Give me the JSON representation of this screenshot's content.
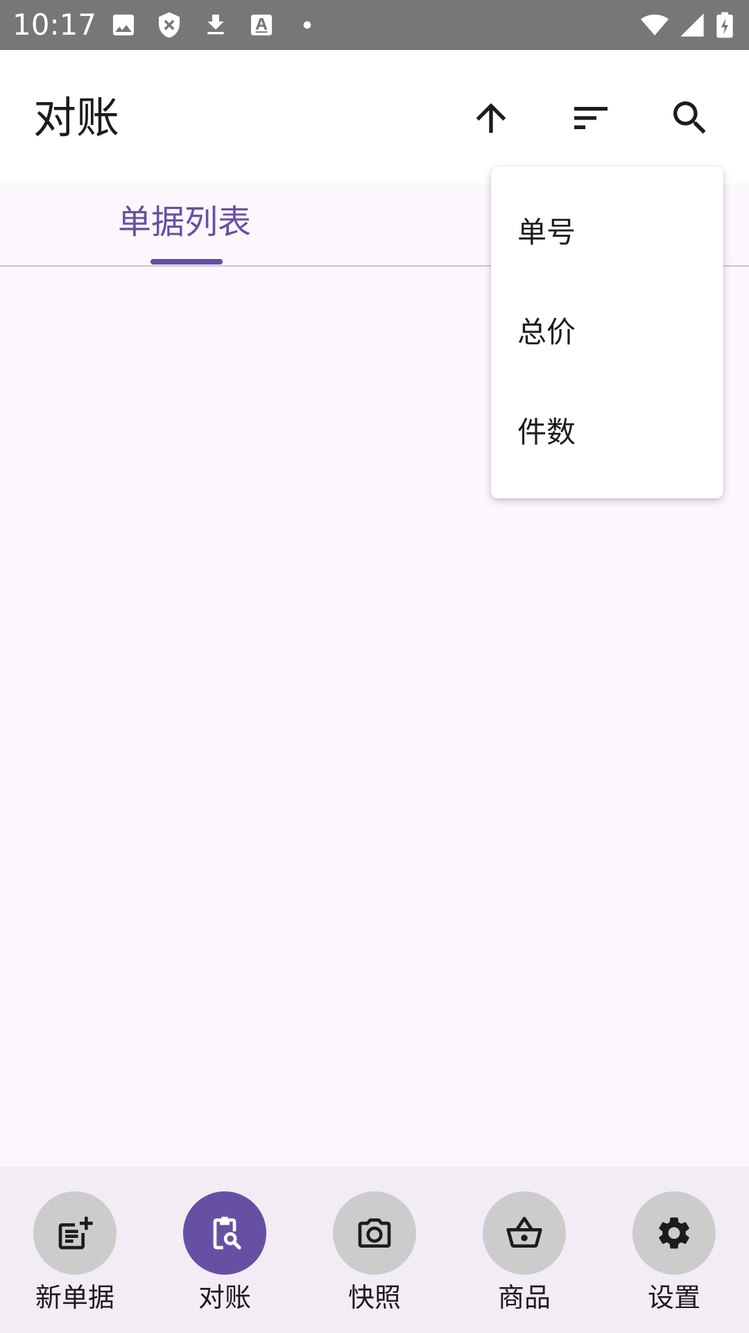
{
  "status_bar": {
    "time": "10:17",
    "icons": [
      "image-icon",
      "shield-icon",
      "download-icon",
      "font-icon",
      "dot-icon",
      "wifi-icon",
      "signal-icon",
      "battery-charging-icon"
    ]
  },
  "app_bar": {
    "title": "对账",
    "actions": [
      "arrow-up-icon",
      "sort-icon",
      "search-icon"
    ]
  },
  "tabs": [
    {
      "label": "单据列表",
      "selected": true
    }
  ],
  "sort_menu": {
    "items": [
      "单号",
      "总价",
      "件数"
    ]
  },
  "bottom_nav": {
    "items": [
      {
        "label": "新单据",
        "icon": "note-add-icon",
        "selected": false
      },
      {
        "label": "对账",
        "icon": "clipboard-search-icon",
        "selected": true
      },
      {
        "label": "快照",
        "icon": "camera-icon",
        "selected": false
      },
      {
        "label": "商品",
        "icon": "basket-icon",
        "selected": false
      },
      {
        "label": "设置",
        "icon": "gear-icon",
        "selected": false
      }
    ]
  },
  "colors": {
    "accent": "#6750a4",
    "status_bar": "#777777",
    "background": "#fcf7fd",
    "nav_background": "#f2ecf5",
    "nav_circle_inactive": "#cccccc"
  }
}
